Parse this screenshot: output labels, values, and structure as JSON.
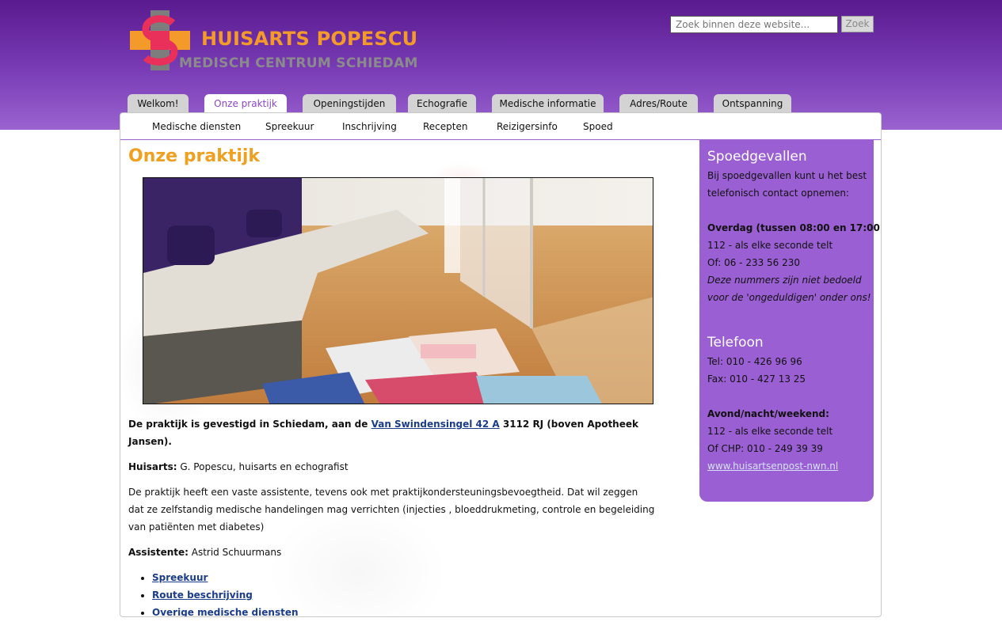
{
  "header": {
    "logo_title": "HUISARTS POPESCU",
    "logo_subtitle": "MEDISCH CENTRUM SCHIEDAM"
  },
  "search": {
    "placeholder": "Zoek binnen deze website...",
    "button_label": "Zoek"
  },
  "tabs": [
    {
      "label": "Welkom!"
    },
    {
      "label": "Onze praktijk",
      "active": true
    },
    {
      "label": "Openingstijden"
    },
    {
      "label": "Echografie"
    },
    {
      "label": "Medische informatie"
    },
    {
      "label": "Adres/Route"
    },
    {
      "label": "Ontspanning"
    }
  ],
  "subnav": [
    {
      "label": "Medische diensten"
    },
    {
      "label": "Spreekuur"
    },
    {
      "label": "Inschrijving"
    },
    {
      "label": "Recepten"
    },
    {
      "label": "Reizigersinfo"
    },
    {
      "label": "Spoed"
    }
  ],
  "main": {
    "title": "Onze praktijk",
    "p1_prefix": "De praktijk is gevestigd in Schiedam, aan de ",
    "p1_link": "Van Swindensingel 42 A",
    "p1_suffix": " 3112 RJ  (boven Apotheek Jansen).",
    "p2_label": "Huisarts:",
    "p2_text": " G. Popescu, huisarts en echografist",
    "p3": "De praktijk heeft een vaste assistente, tevens ook met praktijkondersteuningsbevoegtheid. Dat wil zeggen dat ze zelfstandig medische handelingen mag verrichten (injecties , bloeddrukmeting, controle en begeleiding van patiënten met diabetes)",
    "p4_label": "Assistente:",
    "p4_text": " Astrid Schuurmans",
    "links": [
      "Spreekuur",
      "Route beschrijving",
      "Overige medische diensten"
    ]
  },
  "sidebar": {
    "emergency_title": "Spoedgevallen",
    "emergency_intro_1": "Bij spoedgevallen kunt u het best",
    "emergency_intro_2": "telefonisch contact opnemen:",
    "day_label": "Overdag (tussen 08:00 en 17:00):",
    "day_line1": "112 - als elke seconde telt",
    "day_line2": "Of: 06 - 233 56 230",
    "note_1": "Deze nummers zijn niet bedoeld",
    "note_2": "voor de 'ongeduldigen' onder ons!",
    "phone_title": "Telefoon",
    "tel": "Tel: 010 - 426 96 96",
    "fax": "Fax: 010 - 427 13 25",
    "night_label": "Avond/nacht/weekend:",
    "night_line1": "112 - als elke seconde telt",
    "night_line2": "Of CHP: 010 - 249 39 39",
    "night_link": "www.huisartsenpost-nwn.nl"
  },
  "colors": {
    "header_purple": "#6a2aa0",
    "accent_orange": "#f0a020",
    "sidebar_purple": "#9a5fd2",
    "active_tab_text": "#8b45c8"
  }
}
